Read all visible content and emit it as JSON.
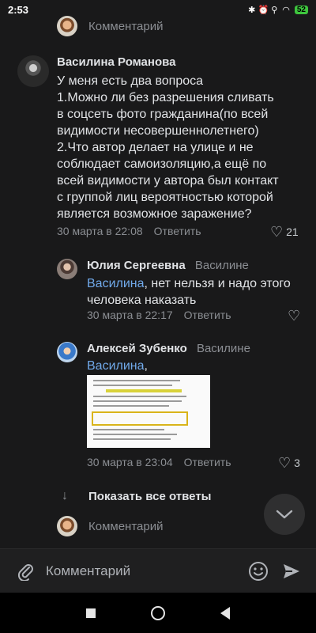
{
  "status_bar": {
    "time": "2:53",
    "icons": "✱ ⏰ ⚲",
    "battery": "52"
  },
  "top_comment_row": {
    "placeholder": "Комментарий"
  },
  "main_comment": {
    "author": "Василина Романова",
    "text_lines": [
      "У меня есть два вопроса",
      "1.Можно ли без разрешения сливать",
      "в соцсеть фото гражданина(по всей",
      "видимости несовершеннолетнего)",
      "2.Что автор делает на улице и не",
      "соблюдает самоизоляцию,а ещё по",
      "всей видимости у автора был контакт",
      "с группой лиц вероятностью которой",
      "является возможное заражение?"
    ],
    "date": "30 марта в 22:08",
    "reply": "Ответить",
    "likes": "21"
  },
  "reply_1": {
    "author": "Юлия Сергеевна",
    "addressee": "Василине",
    "mention": "Василина",
    "text_rest": ", нет нельзя и надо этого",
    "text_line2": "человека наказать",
    "date": "30 марта в 22:17",
    "reply": "Ответить"
  },
  "reply_2": {
    "author": "Алексей Зубенко",
    "addressee": "Василине",
    "mention": "Василина",
    "text_rest": ",",
    "date": "30 марта в 23:04",
    "reply": "Ответить",
    "likes": "3"
  },
  "show_all_replies": "Показать все ответы",
  "bottom_comment_row": {
    "placeholder": "Комментарий"
  },
  "composer": {
    "placeholder": "Комментарий"
  },
  "icons": {
    "paperclip": "paperclip-icon",
    "emoji": "emoji-icon",
    "send": "send-icon",
    "heart": "heart-icon",
    "chevron": "chevron-down-icon"
  },
  "colors": {
    "background": "#19191a",
    "link": "#71aaeb",
    "muted": "#8b8e93"
  }
}
